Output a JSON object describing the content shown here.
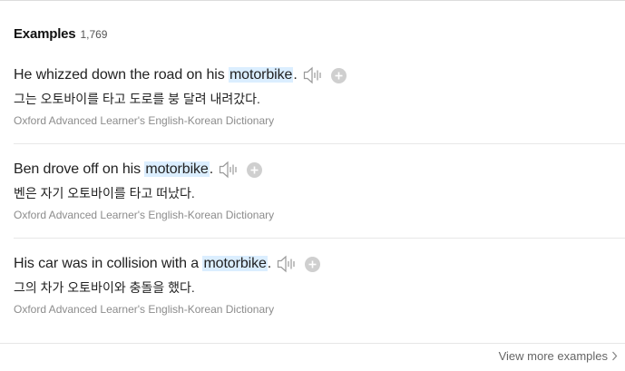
{
  "examples_section": {
    "title": "Examples",
    "count": "1,769"
  },
  "examples": [
    {
      "en_before": "He whizzed down the road on his ",
      "en_highlight": "motorbike",
      "en_after": ".",
      "ko": "그는 오토바이를 타고 도로를 붕 달려 내려갔다.",
      "source": "Oxford Advanced Learner's English-Korean Dictionary",
      "speaker_icon": "speaker-icon",
      "add_icon": "plus-circle-icon"
    },
    {
      "en_before": "Ben drove off on his ",
      "en_highlight": "motorbike",
      "en_after": ".",
      "ko": "벤은 자기 오토바이를 타고 떠났다.",
      "source": "Oxford Advanced Learner's English-Korean Dictionary",
      "speaker_icon": "speaker-icon",
      "add_icon": "plus-circle-icon"
    },
    {
      "en_before": "His car was in collision with a ",
      "en_highlight": "motorbike",
      "en_after": ".",
      "ko": "그의 차가 오토바이와 충돌을 했다.",
      "source": "Oxford Advanced Learner's English-Korean Dictionary",
      "speaker_icon": "speaker-icon",
      "add_icon": "plus-circle-icon"
    }
  ],
  "footer": {
    "view_more_label": "View more examples",
    "chevron_icon": "chevron-right-icon"
  },
  "colors": {
    "highlight": "#dbeeff",
    "text": "#222222",
    "source_text": "#8c8c8c",
    "icon_gray": "#b5b5b5"
  }
}
